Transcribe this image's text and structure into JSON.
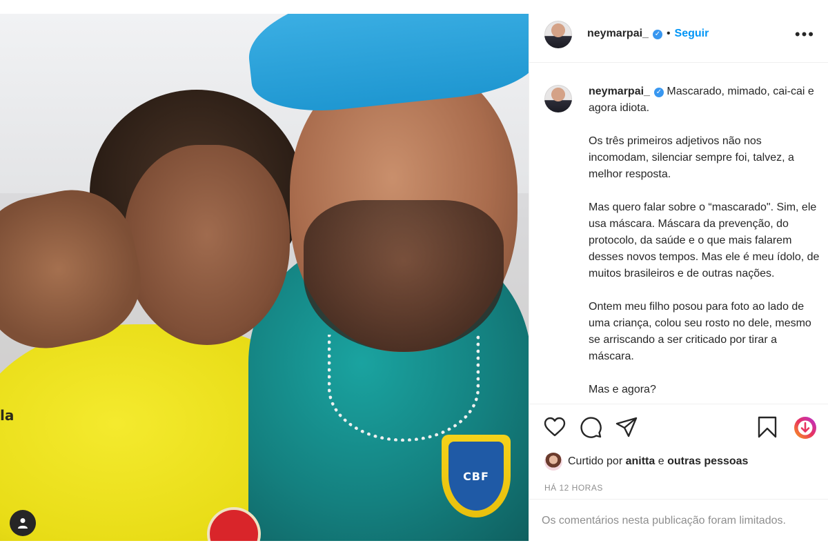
{
  "header": {
    "username": "neymarpai_",
    "separator": "•",
    "follow_label": "Seguir",
    "more_label": "•••"
  },
  "caption": {
    "username": "neymarpai_",
    "text": " Mascarado, mimado, cai-cai e agora idiota.\n\nOs três primeiros adjetivos não nos incomodam, silenciar sempre foi, talvez, a melhor resposta.\n\nMas quero falar sobre o “mascarado\". Sim, ele usa máscara. Máscara da prevenção, do protocolo, da saúde e o que mais falarem desses novos tempos. Mas ele é meu ídolo, de muitos brasileiros e de outras nações.\n\nOntem meu filho posou para foto ao lado de uma criança, colou seu rosto no dele, mesmo se arriscando a ser criticado por tirar a máscara.\n\nMas e agora?"
  },
  "photo": {
    "badge_text": "CBF",
    "shirt_text": "la"
  },
  "likes": {
    "prefix": "Curtido por ",
    "user": "anitta",
    "middle": " e ",
    "others": "outras pessoas"
  },
  "timestamp": "HÁ 12 HORAS",
  "comments_limited": "Os comentários nesta publicação foram limitados.",
  "colors": {
    "accent": "#0095f6",
    "verified": "#3897f0",
    "muted": "#8e8e8e"
  },
  "icons": [
    "user-tag-icon",
    "verified-icon",
    "more-options-icon",
    "heart-icon",
    "comment-icon",
    "share-icon",
    "bookmark-icon",
    "download-icon"
  ]
}
